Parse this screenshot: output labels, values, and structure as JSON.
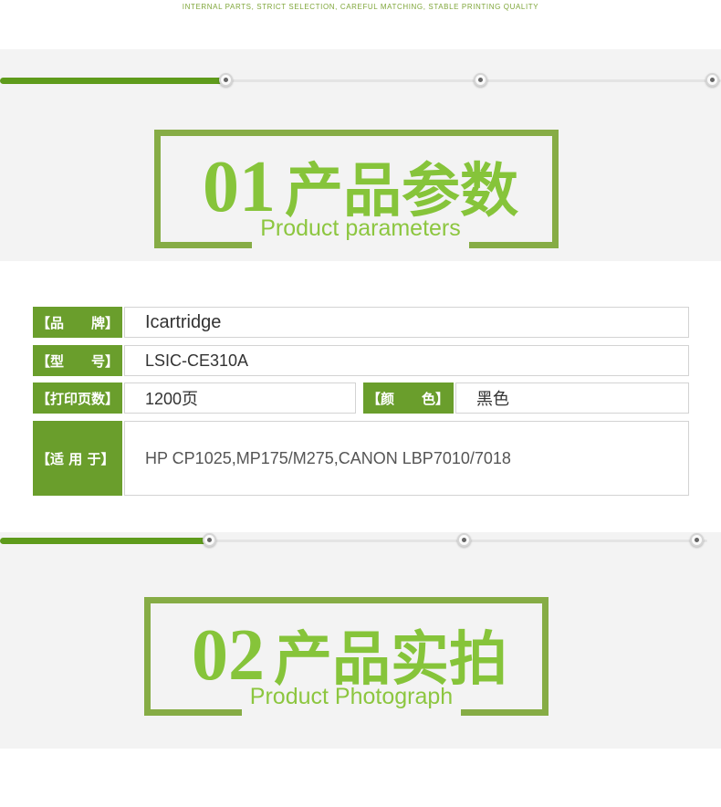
{
  "tagline": "INTERNAL PARTS, STRICT SELECTION, CAREFUL MATCHING, STABLE PRINTING QUALITY",
  "colors": {
    "accent_green": "#6a9e2c",
    "title_green": "#86c43a",
    "frame_green": "#86ac45",
    "band_gray": "#f3f3f3"
  },
  "section1": {
    "progress": 0.31,
    "number": "01",
    "title_cn": "产品参数",
    "title_en": "Product parameters"
  },
  "params": {
    "brand_label": "【品　　牌】",
    "brand_value": "Icartridge",
    "model_label": "【型　　号】",
    "model_value": "LSIC-CE310A",
    "pages_label": "【打印页数】",
    "pages_value": "1200页",
    "color_label": "【颜　　色】",
    "color_value": "黑色",
    "compat_label": "【适 用 于】",
    "compat_value": "HP CP1025,MP175/M275,CANON LBP7010/7018"
  },
  "section2": {
    "progress": 0.29,
    "number": "02",
    "title_cn": "产品实拍",
    "title_en": "Product Photograph"
  }
}
